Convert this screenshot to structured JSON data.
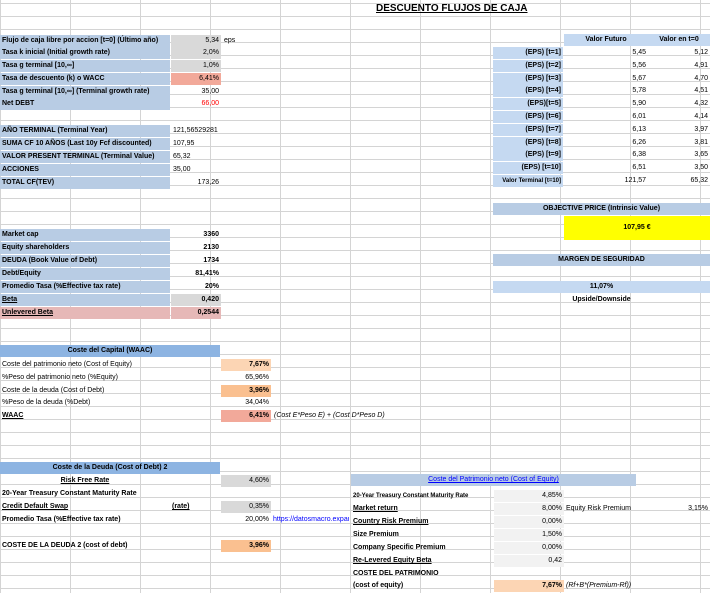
{
  "title": "DESCUENTO FLUJOS DE CAJA",
  "inputs": {
    "fcf_label": "Flujo de caja libre por accion [t=0] (Último año)",
    "fcf_value": "5,34",
    "fcf_unit": "eps",
    "k_label": "Tasa k inicial (Initial growth rate)",
    "k_value": "2,0%",
    "g_label": "Tasa g terminal [10,∞]",
    "g_value": "1,0%",
    "wacc_label": "Tasa de descuento (k) o WACC",
    "wacc_value": "6,41%",
    "g_growth_label": "Tasa g terminal [10,∞] (Terminal growth rate)",
    "g_growth_value": "35,00",
    "debt_label": "Net DEBT",
    "debt_value": "66,00"
  },
  "terminal": {
    "year_label": "AÑO TERMINAL (Terminal Year)",
    "year_value": "121,56529281",
    "sum_label": "SUMA CF 10 AÑOS (Last 10y Fcf discounted)",
    "sum_value": "107,95",
    "vp_label": "VALOR PRESENT TERMINAL (Terminal Value)",
    "vp_value": "65,32",
    "acc_label": "ACCIONES",
    "acc_value": "35,00",
    "total_label": "TOTAL CF(TEV)",
    "total_value": "173,26"
  },
  "eps_table": {
    "h1": "Valor Futuro",
    "h2": "Valor en t=0",
    "rows": [
      {
        "label": "(EPS) [t=1]",
        "fv": "5,45",
        "pv": "5,12"
      },
      {
        "label": "(EPS) [t=2]",
        "fv": "5,56",
        "pv": "4,91"
      },
      {
        "label": "(EPS) [t=3]",
        "fv": "5,67",
        "pv": "4,70"
      },
      {
        "label": "(EPS) [t=4]",
        "fv": "5,78",
        "pv": "4,51"
      },
      {
        "label": "(EPS)[t=5]",
        "fv": "5,90",
        "pv": "4,32"
      },
      {
        "label": "(EPS) [t=6]",
        "fv": "6,01",
        "pv": "4,14"
      },
      {
        "label": "(EPS) [t=7]",
        "fv": "6,13",
        "pv": "3,97"
      },
      {
        "label": "(EPS) [t=8]",
        "fv": "6,26",
        "pv": "3,81"
      },
      {
        "label": "(EPS) [t=9]",
        "fv": "6,38",
        "pv": "3,65"
      },
      {
        "label": "(EPS) [t=10]",
        "fv": "6,51",
        "pv": "3,50"
      },
      {
        "label": "Valor Terminal [t=10]",
        "fv": "121,57",
        "pv": "65,32"
      }
    ]
  },
  "objective": {
    "label": "OBJECTIVE PRICE (Intrinsic Value)",
    "value": "107,95 €"
  },
  "margin": {
    "label": "MARGEN DE SEGURIDAD",
    "value": "11,07%",
    "sub": "Upside/Downside"
  },
  "market": {
    "rows": [
      {
        "label": "Market cap",
        "value": "3360"
      },
      {
        "label": "Equity shareholders",
        "value": "2130"
      },
      {
        "label": "DEUDA (Book Value of Debt)",
        "value": "1734"
      },
      {
        "label": "Debt/Equity",
        "value": "81,41%"
      },
      {
        "label": "Promedio Tasa (%Effective tax rate)",
        "value": "20%"
      },
      {
        "label": "Beta",
        "value": "0,420"
      },
      {
        "label": "Unlevered Beta",
        "value": "0,2544"
      }
    ]
  },
  "wacc": {
    "header": "Coste del Capital (WAAC)",
    "rows": [
      {
        "label": "Coste del patrimonio neto (Cost of Equity)",
        "value": "7,67%"
      },
      {
        "label": "%Peso del patrimonio neto (%Equity)",
        "value": "65,96%"
      },
      {
        "label": "Coste de la deuda (Cost of Debt)",
        "value": "3,96%"
      },
      {
        "label": "%Peso de la deuda (%Debt)",
        "value": "34,04%"
      },
      {
        "label": "WAAC",
        "value": "6,41%"
      }
    ],
    "formula": "(Cost E*Peso E) + (Cost D*Peso D)"
  },
  "debt_cost": {
    "header": "Coste de la Deuda (Cost of Debt) 2",
    "rf_label": "Risk Free Rate",
    "rf_value": "4,60%",
    "t20_label": "20-Year Treasury Constant Maturity Rate",
    "cds_label": "Credit Default Swap",
    "cds_note": "(rate)",
    "cds_value": "0,35%",
    "tax_label": "Promedio Tasa (%Effective tax rate)",
    "tax_value": "20,00%",
    "tax_link": "https://datosmacro.expansion.com",
    "total_label": "COSTE DE LA DEUDA 2 (cost of debt)",
    "total_value": "3,96%"
  },
  "equity_cost": {
    "header": "Coste del Patrimonio neto (Cost of Equity)",
    "rows": [
      {
        "label": "20-Year Treasury Constant Maturity Rate",
        "value": "4,85%"
      },
      {
        "label": "Market return",
        "value": "8,00%"
      },
      {
        "label": "Country Risk Premium",
        "value": "0,00%"
      },
      {
        "label": "Size Premium",
        "value": "1,50%"
      },
      {
        "label": "Company Specific Premium",
        "value": "0,00%"
      },
      {
        "label": "Re-Levered Equity Beta",
        "value": "0,42"
      }
    ],
    "erp_label": "Equity Risk Premium",
    "erp_value": "3,15%",
    "total_label1": "COSTE DEL PATRIMONIO",
    "total_label2": "(cost of equity)",
    "total_value": "7,67%",
    "formula": "(Rf+B*(Premium-Rf))"
  }
}
